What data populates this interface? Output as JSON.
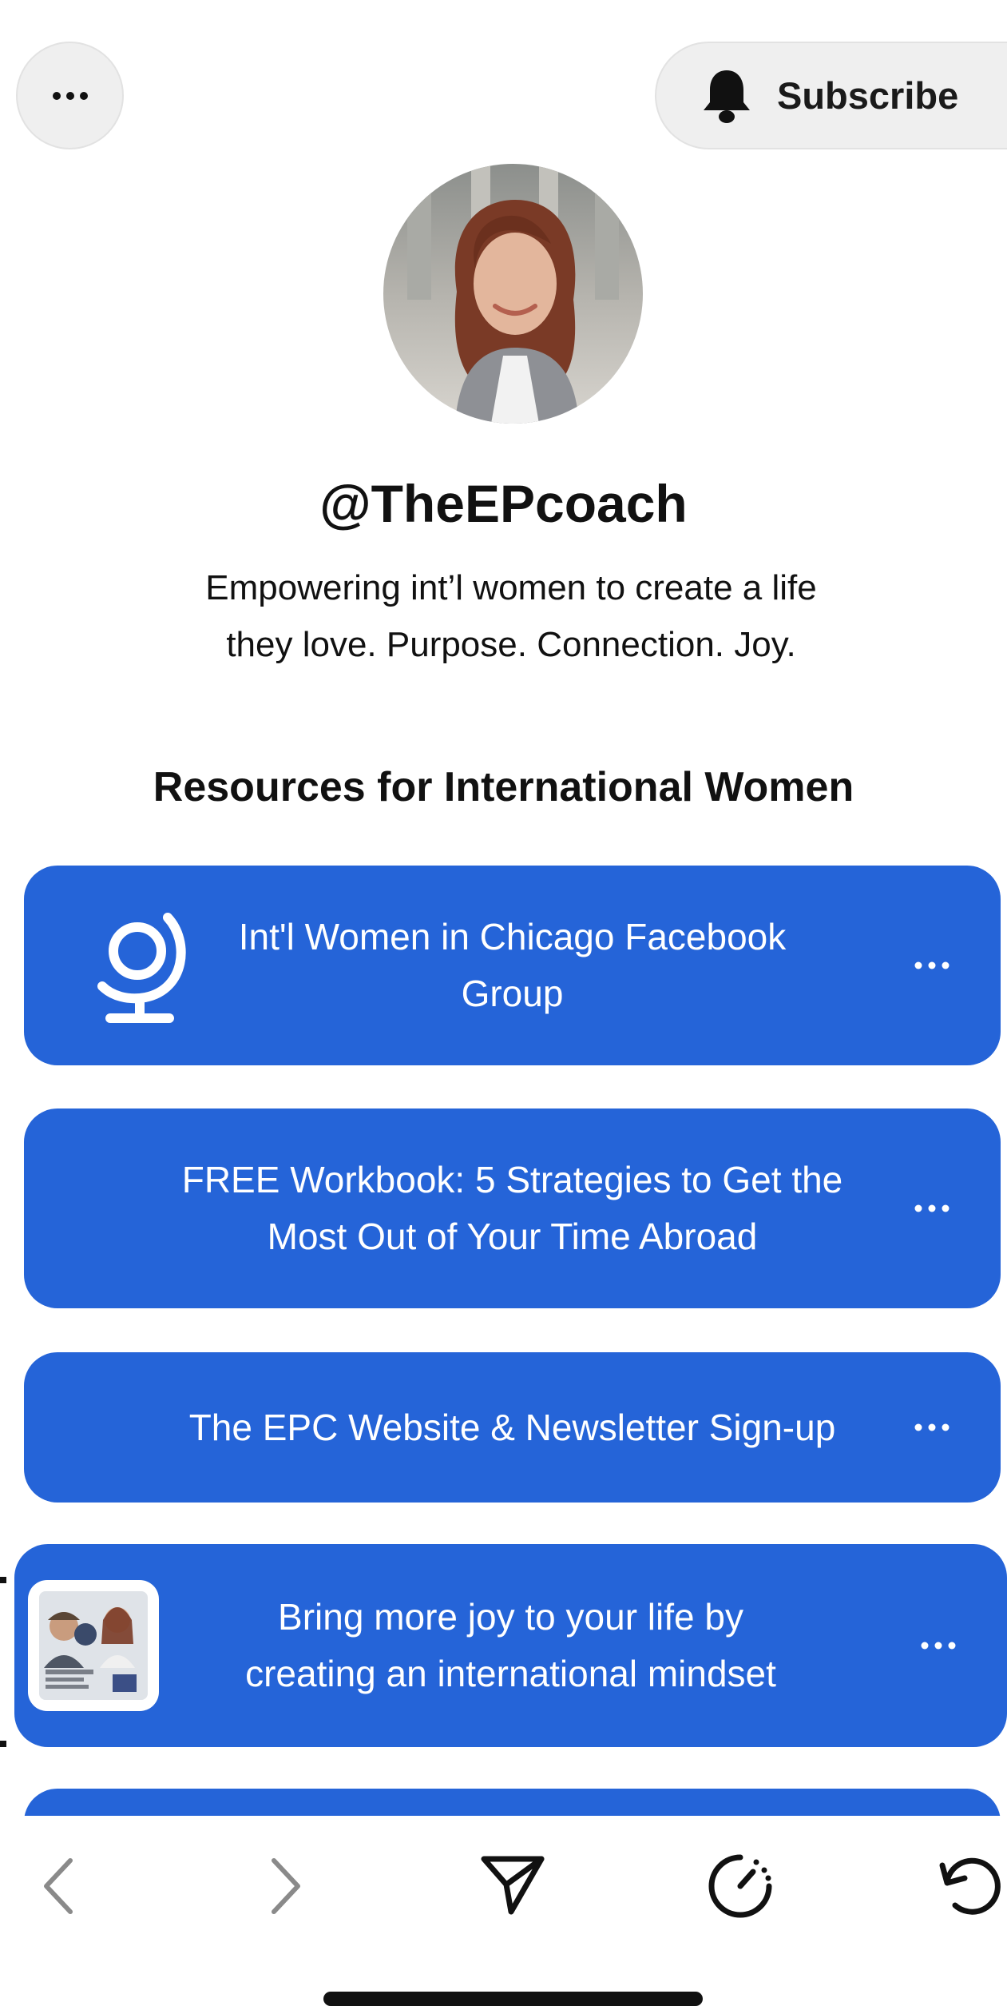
{
  "header": {
    "more_label": "More options",
    "subscribe_label": "Subscribe"
  },
  "profile": {
    "handle": "@TheEPcoach",
    "bio_line1": "Empowering int’l women to create a life",
    "bio_line2": "they love. Purpose. Connection. Joy."
  },
  "section": {
    "title": "Resources for International Women"
  },
  "links": [
    {
      "line1": "Int'l Women in Chicago Facebook",
      "line2": "Group",
      "icon": "globe-icon"
    },
    {
      "line1": "FREE Workbook: 5 Strategies to Get the",
      "line2": "Most Out of Your Time Abroad"
    },
    {
      "line1": "The EPC Website & Newsletter Sign-up"
    },
    {
      "line1": "Bring more joy to your life by",
      "line2": "creating an international mindset",
      "thumbnail": "podcast-episode-thumbnail"
    }
  ],
  "browser_nav": {
    "back": "chevron-left-icon",
    "forward": "chevron-right-icon",
    "share": "send-icon",
    "speed": "speed-gauge-icon",
    "reload": "reload-icon"
  },
  "colors": {
    "card_blue": "#2564d8",
    "chip_grey": "#efefef"
  }
}
